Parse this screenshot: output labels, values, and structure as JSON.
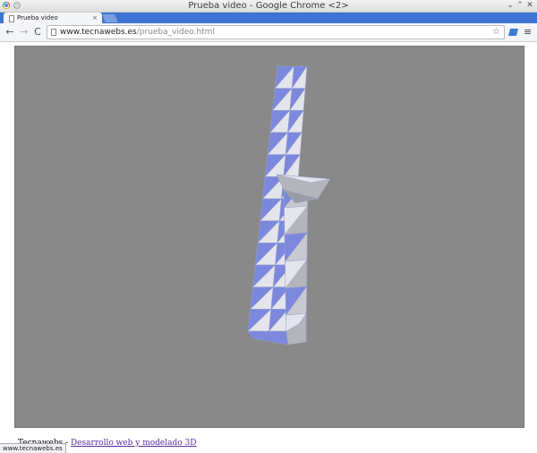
{
  "window": {
    "title": "Prueba video - Google Chrome <2>"
  },
  "tabs": [
    {
      "label": "Prueba video",
      "close_glyph": "×"
    }
  ],
  "toolbar": {
    "back_glyph": "←",
    "forward_glyph": "→",
    "reload_glyph": "C",
    "url_host": "www.tecnawebs.es",
    "url_path": "/prueba_video.html",
    "star_glyph": "☆",
    "menu_glyph": "≡"
  },
  "footer": {
    "prefix": "Tecnawebs - ",
    "link_text": "Desarrollo web y modelado 3D"
  },
  "status": {
    "text": "www.tecnawebs.es"
  },
  "colors": {
    "canvas_bg": "#898989",
    "face_blue": "#7b88de",
    "face_white": "#e4e4ec",
    "face_gray": "#b4b4bc",
    "tabstrip": "#3e74d1"
  },
  "icons": {
    "browser": "chrome-icon",
    "tab_page": "page-icon",
    "new_tab": "new-tab-icon",
    "extension": "extension-icon"
  }
}
